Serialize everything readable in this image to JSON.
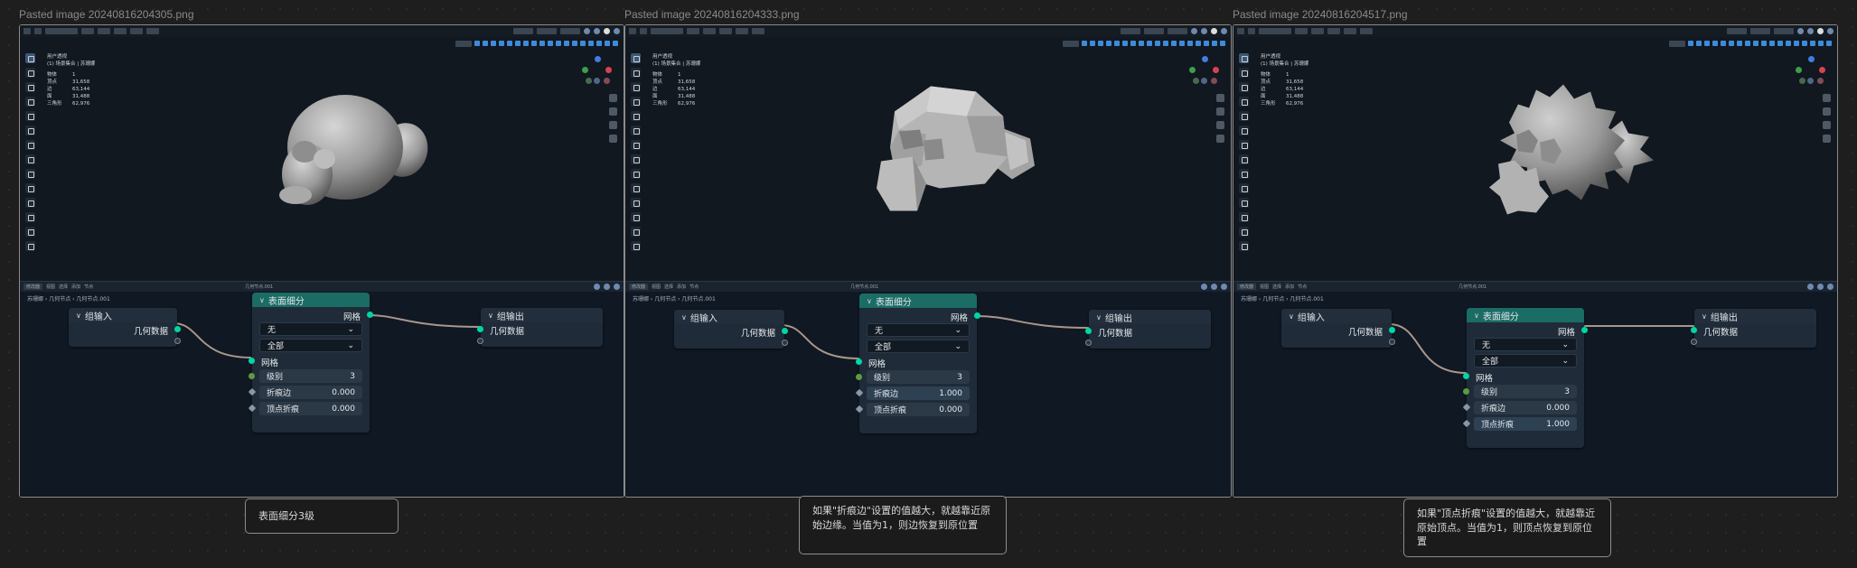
{
  "panels": [
    {
      "caption": "Pasted image 20240816204305.png",
      "stats": {
        "title": "用户透视",
        "sub": "(1) 场景集合 | 苏珊娜",
        "rows": [
          [
            "物体",
            "1"
          ],
          [
            "顶点",
            "31,658"
          ],
          [
            "边",
            "63,144"
          ],
          [
            "面",
            "31,488"
          ],
          [
            "三角形",
            "62,976"
          ]
        ]
      },
      "node_header": {
        "editor": "修改器",
        "menus": [
          "视图",
          "选择",
          "添加",
          "节点"
        ],
        "nodegroup": "几何节点.001"
      },
      "breadcrumb": "苏珊娜  ›  几何节点  ›  几何节点.001",
      "group_input": {
        "title": "组输入",
        "output": "几何数据"
      },
      "group_output": {
        "title": "组输出",
        "input": "几何数据"
      },
      "subdiv": {
        "title": "表面细分",
        "out": "网格",
        "dd1": "无",
        "dd2": "全部",
        "in": "网格",
        "level_label": "级别",
        "level": "3",
        "crease_edge_label": "折痕边",
        "crease_edge": "0.000",
        "crease_vert_label": "顶点折痕",
        "crease_vert": "0.000"
      }
    },
    {
      "caption": "Pasted image 20240816204333.png",
      "stats": {
        "title": "用户透视",
        "sub": "(1) 场景集合 | 苏珊娜",
        "rows": [
          [
            "物体",
            "1"
          ],
          [
            "顶点",
            "31,658"
          ],
          [
            "边",
            "63,144"
          ],
          [
            "面",
            "31,488"
          ],
          [
            "三角形",
            "62,976"
          ]
        ]
      },
      "node_header": {
        "editor": "修改器",
        "menus": [
          "视图",
          "选择",
          "添加",
          "节点"
        ],
        "nodegroup": "几何节点.001"
      },
      "breadcrumb": "苏珊娜  ›  几何节点  ›  几何节点.001",
      "group_input": {
        "title": "组输入",
        "output": "几何数据"
      },
      "group_output": {
        "title": "组输出",
        "input": "几何数据"
      },
      "subdiv": {
        "title": "表面细分",
        "out": "网格",
        "dd1": "无",
        "dd2": "全部",
        "in": "网格",
        "level_label": "级别",
        "level": "3",
        "crease_edge_label": "折痕边",
        "crease_edge": "1.000",
        "crease_vert_label": "顶点折痕",
        "crease_vert": "0.000"
      }
    },
    {
      "caption": "Pasted image 20240816204517.png",
      "stats": {
        "title": "用户透视",
        "sub": "(1) 场景集合 | 苏珊娜",
        "rows": [
          [
            "物体",
            "1"
          ],
          [
            "顶点",
            "31,658"
          ],
          [
            "边",
            "63,144"
          ],
          [
            "面",
            "31,488"
          ],
          [
            "三角形",
            "62,976"
          ]
        ]
      },
      "node_header": {
        "editor": "修改器",
        "menus": [
          "视图",
          "选择",
          "添加",
          "节点"
        ],
        "nodegroup": "几何节点.001"
      },
      "breadcrumb": "苏珊娜  ›  几何节点  ›  几何节点.001",
      "group_input": {
        "title": "组输入",
        "output": "几何数据"
      },
      "group_output": {
        "title": "组输出",
        "input": "几何数据"
      },
      "subdiv": {
        "title": "表面细分",
        "out": "网格",
        "dd1": "无",
        "dd2": "全部",
        "in": "网格",
        "level_label": "级别",
        "level": "3",
        "crease_edge_label": "折痕边",
        "crease_edge": "0.000",
        "crease_vert_label": "顶点折痕",
        "crease_vert": "1.000"
      }
    }
  ],
  "notes": [
    "表面细分3级",
    "如果\"折痕边\"设置的值越大，就越靠近原始边缘。当值为1，则边恢复到原位置",
    "如果\"顶点折痕\"设置的值越大，就越靠近原始顶点。当值为1，则顶点恢复到原位置"
  ],
  "colors": {
    "socket_geometry": "#00d6a3",
    "subdiv_header": "#1a6c64",
    "canvas": "#1e1e1e"
  }
}
